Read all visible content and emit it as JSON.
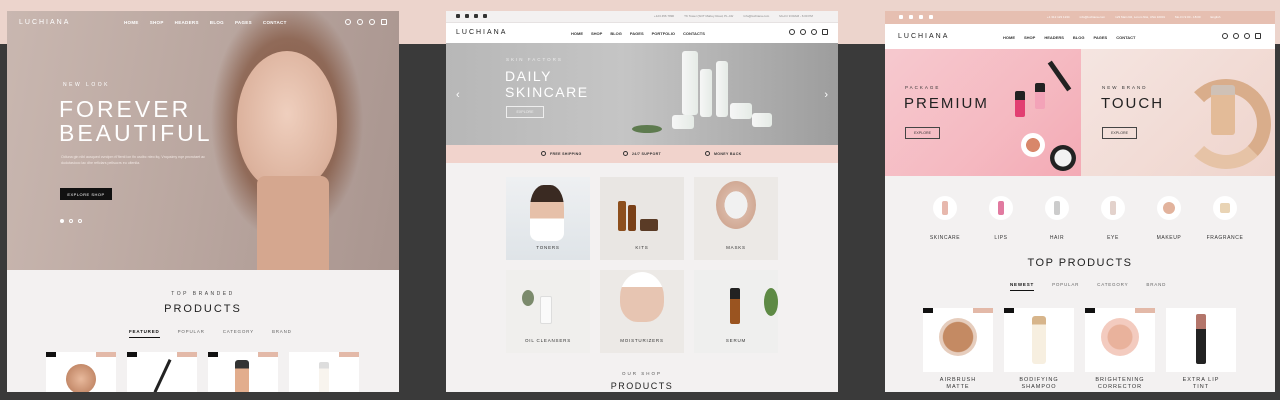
{
  "brand": "LUCHIANA",
  "colors": {
    "accent_pink": "#ecd4cc",
    "dark": "#111111",
    "strip": "#f1d3cc"
  },
  "panel1": {
    "nav": [
      "HOME",
      "SHOP",
      "HEADERS",
      "BLOG",
      "PAGES",
      "CONTACT"
    ],
    "hero": {
      "kicker": "NEW LOOK",
      "title_line1": "FOREVER",
      "title_line2": "BEAUTIFUL",
      "description": "Odiuna gin nibl ausqued cvndpm ril'flenti ion fin usdbc nteo itq. Vnqusimy nqe pncrutaet ac dudutasiooc lac dhe reficlars pellsucrs eu ultenlia.",
      "button": "EXPLORE SHOP"
    },
    "section_kicker": "TOP BRANDED",
    "section_title": "PRODUCTS",
    "tabs": [
      "FEATURED",
      "POPULAR",
      "CATEGORY",
      "BRAND"
    ]
  },
  "panel2": {
    "contacts": [
      "+123 456 7890",
      "TK Tower (SOT Mabuy Road, PL-Cltr",
      "Info@luchiana.com",
      "Mo-Fri 9:00AM - 6:00 PM"
    ],
    "nav": [
      "HOME",
      "SHOP",
      "BLOG",
      "PAGES",
      "PORTFOLIO",
      "CONTACTS"
    ],
    "hero": {
      "kicker": "SKIN FACTORS",
      "title_line1": "DAILY",
      "title_line2": "SKINCARE",
      "button": "EXPLORE"
    },
    "features": [
      "FREE SHIPPING",
      "24/7 SUPPORT",
      "MONEY BACK"
    ],
    "tiles": [
      "TONERS",
      "KITS",
      "MASKS",
      "OIL CLEANSERS",
      "MOISTURIZERS",
      "SERUM"
    ],
    "section_kicker": "OUR SHOP",
    "section_title": "PRODUCTS"
  },
  "panel3": {
    "contacts": [
      "+1 312 123 1234",
      "info@luchiana.com",
      "123 Main Rd, Lorum Nisi, USA 10001",
      "Mo-Fri 9:00 - 18:00",
      "English"
    ],
    "nav": [
      "HOME",
      "SHOP",
      "HEADERS",
      "BLOG",
      "PAGES",
      "CONTACT"
    ],
    "banner1": {
      "kicker": "PACKAGE",
      "title": "PREMIUM",
      "button": "EXPLORE"
    },
    "banner2": {
      "kicker": "NEW BRAND",
      "title": "TOUCH",
      "button": "EXPLORE"
    },
    "categories": [
      "SKINCARE",
      "LIPS",
      "HAIR",
      "EYE",
      "MAKEUP",
      "FRAGRANCE"
    ],
    "section_title": "TOP PRODUCTS",
    "tabs": [
      "NEWEST",
      "POPULAR",
      "CATEGORY",
      "BRAND"
    ],
    "products": [
      {
        "l1": "AIRBRUSH",
        "l2": "MATTE"
      },
      {
        "l1": "BODIFYING",
        "l2": "SHAMPOO"
      },
      {
        "l1": "BRIGHTENING",
        "l2": "CORRECTOR"
      },
      {
        "l1": "EXTRA LIP",
        "l2": "TINT"
      }
    ]
  }
}
